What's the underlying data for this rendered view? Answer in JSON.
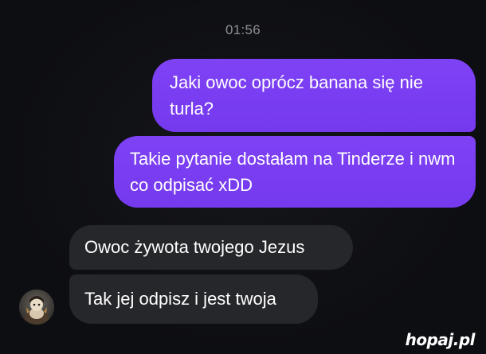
{
  "chat": {
    "timestamp": "01:56",
    "messages": [
      {
        "side": "sent",
        "text": "Jaki owoc oprócz banana się nie turla?"
      },
      {
        "side": "sent",
        "text": "Takie pytanie dostałam na Tinderze i nwm co odpisać xDD"
      },
      {
        "side": "received",
        "text": "Owoc żywota twojego Jezus"
      },
      {
        "side": "received",
        "text": "Tak jej odpisz i jest twoja"
      }
    ],
    "avatar_icon": "user-avatar-icon"
  },
  "colors": {
    "background": "#0d0e11",
    "sent_bubble": "#7b3ff2",
    "received_bubble": "#26272b",
    "timestamp_text": "#8e8f96"
  },
  "watermark": {
    "text": "hopaj.pl"
  }
}
